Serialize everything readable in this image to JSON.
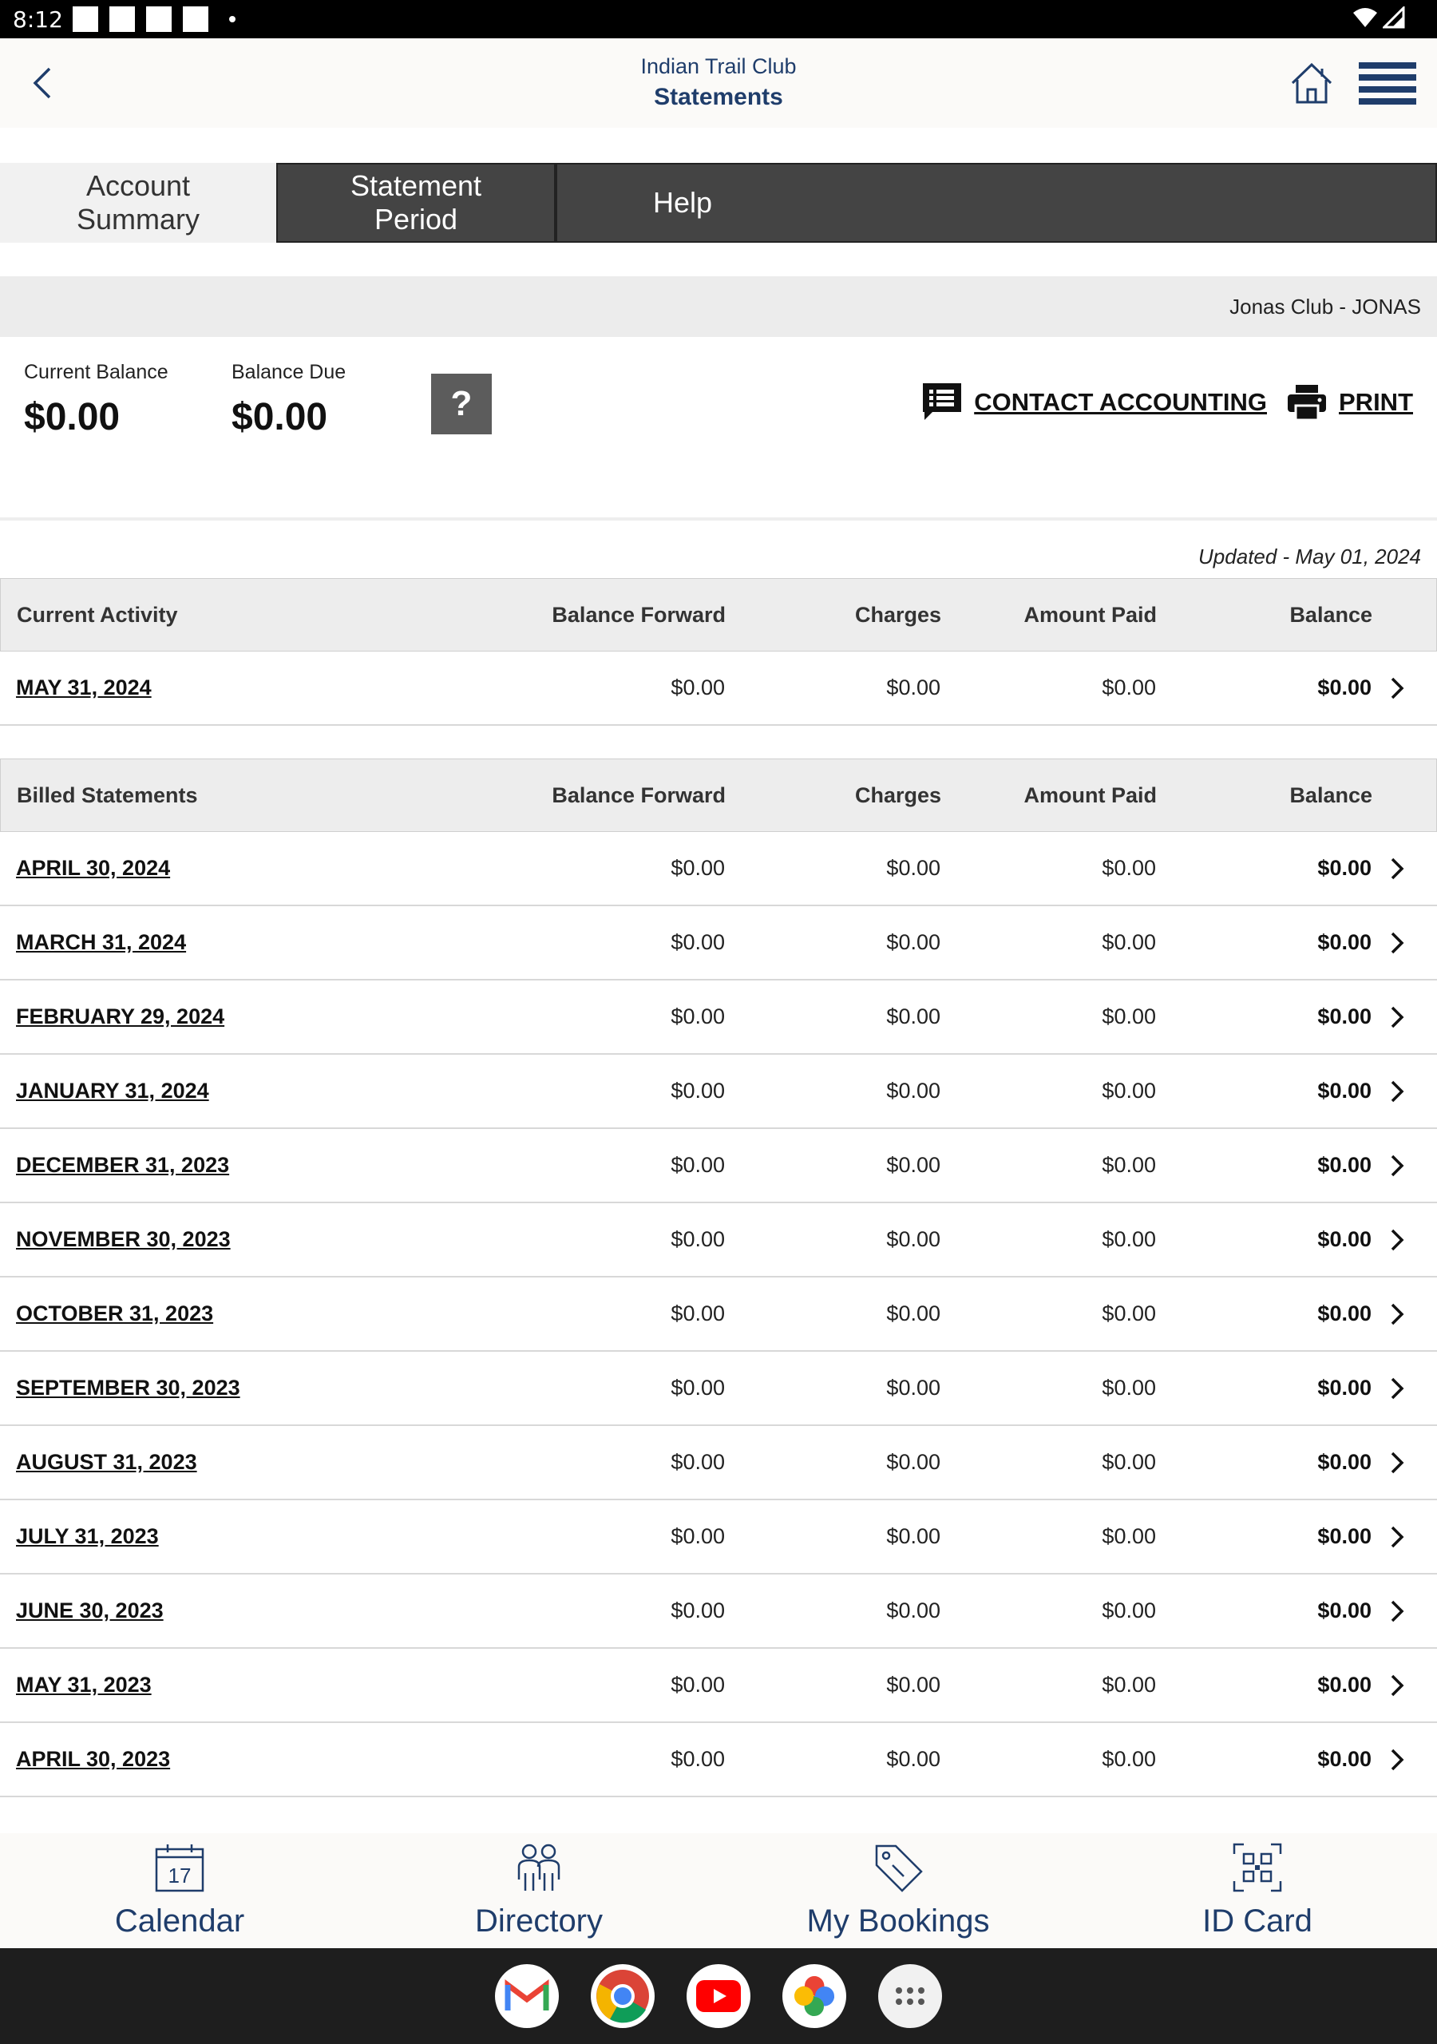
{
  "status_bar": {
    "time": "8:12"
  },
  "header": {
    "club_name": "Indian Trail Club",
    "title": "Statements"
  },
  "tabs": [
    {
      "label": "Account\nSummary",
      "active": true
    },
    {
      "label": "Statement\nPeriod",
      "active": false
    },
    {
      "label": "Help",
      "active": false
    }
  ],
  "club_strip": "Jonas Club - JONAS",
  "balances": {
    "current_label": "Current Balance",
    "current_value": "$0.00",
    "due_label": "Balance Due",
    "due_value": "$0.00",
    "help_glyph": "?"
  },
  "actions": {
    "contact": "CONTACT ACCOUNTING",
    "print": "PRINT"
  },
  "updated": "Updated - May 01, 2024",
  "columns": {
    "balance_forward": "Balance Forward",
    "charges": "Charges",
    "amount_paid": "Amount Paid",
    "balance": "Balance"
  },
  "current_activity": {
    "header": "Current Activity",
    "rows": [
      {
        "date": "MAY 31, 2024",
        "balance_forward": "$0.00",
        "charges": "$0.00",
        "amount_paid": "$0.00",
        "balance": "$0.00"
      }
    ]
  },
  "billed_statements": {
    "header": "Billed Statements",
    "rows": [
      {
        "date": "APRIL 30, 2024",
        "balance_forward": "$0.00",
        "charges": "$0.00",
        "amount_paid": "$0.00",
        "balance": "$0.00"
      },
      {
        "date": "MARCH 31, 2024",
        "balance_forward": "$0.00",
        "charges": "$0.00",
        "amount_paid": "$0.00",
        "balance": "$0.00"
      },
      {
        "date": "FEBRUARY 29, 2024",
        "balance_forward": "$0.00",
        "charges": "$0.00",
        "amount_paid": "$0.00",
        "balance": "$0.00"
      },
      {
        "date": "JANUARY 31, 2024",
        "balance_forward": "$0.00",
        "charges": "$0.00",
        "amount_paid": "$0.00",
        "balance": "$0.00"
      },
      {
        "date": "DECEMBER 31, 2023",
        "balance_forward": "$0.00",
        "charges": "$0.00",
        "amount_paid": "$0.00",
        "balance": "$0.00"
      },
      {
        "date": "NOVEMBER 30, 2023",
        "balance_forward": "$0.00",
        "charges": "$0.00",
        "amount_paid": "$0.00",
        "balance": "$0.00"
      },
      {
        "date": "OCTOBER 31, 2023",
        "balance_forward": "$0.00",
        "charges": "$0.00",
        "amount_paid": "$0.00",
        "balance": "$0.00"
      },
      {
        "date": "SEPTEMBER 30, 2023",
        "balance_forward": "$0.00",
        "charges": "$0.00",
        "amount_paid": "$0.00",
        "balance": "$0.00"
      },
      {
        "date": "AUGUST 31, 2023",
        "balance_forward": "$0.00",
        "charges": "$0.00",
        "amount_paid": "$0.00",
        "balance": "$0.00"
      },
      {
        "date": "JULY 31, 2023",
        "balance_forward": "$0.00",
        "charges": "$0.00",
        "amount_paid": "$0.00",
        "balance": "$0.00"
      },
      {
        "date": "JUNE 30, 2023",
        "balance_forward": "$0.00",
        "charges": "$0.00",
        "amount_paid": "$0.00",
        "balance": "$0.00"
      },
      {
        "date": "MAY 31, 2023",
        "balance_forward": "$0.00",
        "charges": "$0.00",
        "amount_paid": "$0.00",
        "balance": "$0.00"
      },
      {
        "date": "APRIL 30, 2023",
        "balance_forward": "$0.00",
        "charges": "$0.00",
        "amount_paid": "$0.00",
        "balance": "$0.00"
      }
    ]
  },
  "bottom_nav": [
    {
      "label": "Calendar",
      "icon": "calendar-icon",
      "day": "17"
    },
    {
      "label": "Directory",
      "icon": "people-icon"
    },
    {
      "label": "My Bookings",
      "icon": "tag-icon"
    },
    {
      "label": "ID Card",
      "icon": "qr-code-icon"
    }
  ],
  "android_apps": [
    "gmail-icon",
    "chrome-icon",
    "youtube-icon",
    "photos-icon",
    "app-drawer-icon"
  ],
  "colors": {
    "brand": "#1f3d6b",
    "tab_dark": "#444444",
    "help_button": "#5c5c5c"
  }
}
